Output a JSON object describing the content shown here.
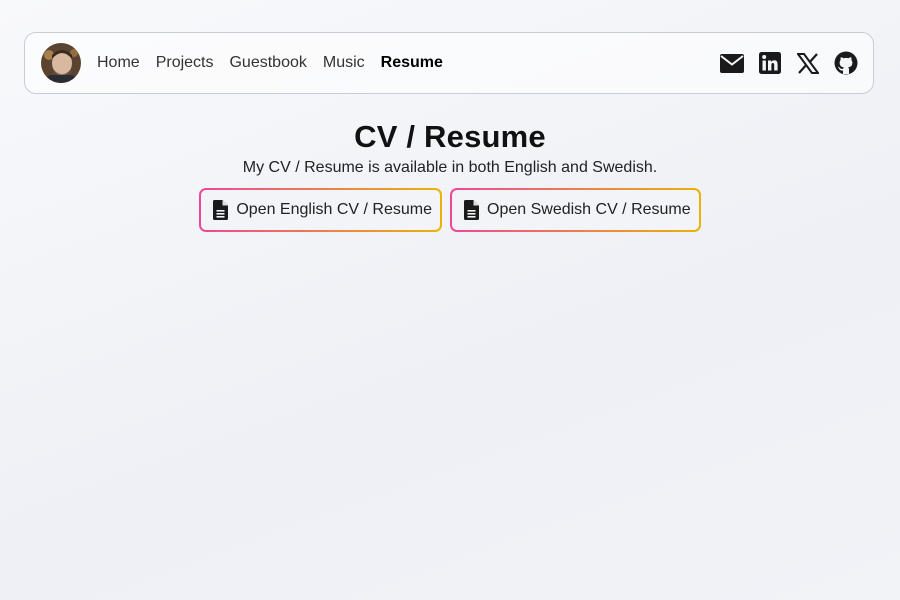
{
  "nav": {
    "avatar_alt": "Profile photo",
    "links": [
      {
        "label": "Home",
        "active": false
      },
      {
        "label": "Projects",
        "active": false
      },
      {
        "label": "Guestbook",
        "active": false
      },
      {
        "label": "Music",
        "active": false
      },
      {
        "label": "Resume",
        "active": true
      }
    ],
    "social": [
      {
        "icon": "envelope-icon"
      },
      {
        "icon": "linkedin-icon"
      },
      {
        "icon": "x-icon"
      },
      {
        "icon": "github-icon"
      }
    ]
  },
  "main": {
    "title": "CV / Resume",
    "subtitle": "My CV / Resume is available in both English and Swedish.",
    "buttons": [
      {
        "label": "Open English CV / Resume",
        "icon": "document-icon"
      },
      {
        "label": "Open Swedish CV / Resume",
        "icon": "document-icon"
      }
    ]
  },
  "colors": {
    "gradient_start": "#ec4899",
    "gradient_end": "#eab308",
    "border": "#c9ccd3"
  }
}
